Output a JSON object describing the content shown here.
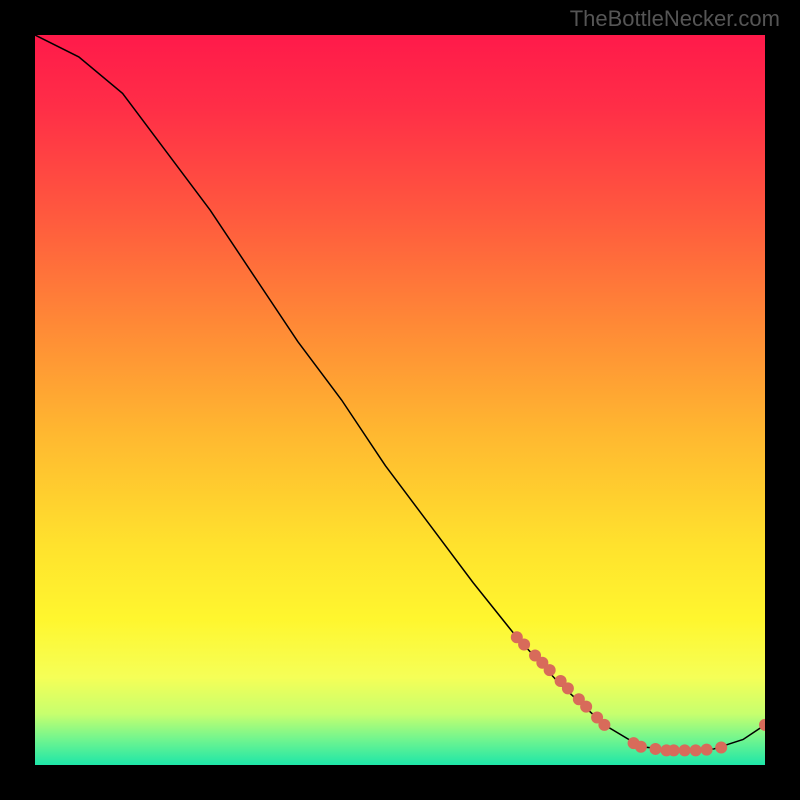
{
  "watermark": "TheBottleNecker.com",
  "chart_data": {
    "type": "line",
    "title": "",
    "xlabel": "",
    "ylabel": "",
    "xlim": [
      0,
      100
    ],
    "ylim": [
      0,
      100
    ],
    "curve": [
      {
        "x": 0,
        "y": 100
      },
      {
        "x": 6,
        "y": 97
      },
      {
        "x": 12,
        "y": 92
      },
      {
        "x": 18,
        "y": 84
      },
      {
        "x": 24,
        "y": 76
      },
      {
        "x": 30,
        "y": 67
      },
      {
        "x": 36,
        "y": 58
      },
      {
        "x": 42,
        "y": 50
      },
      {
        "x": 48,
        "y": 41
      },
      {
        "x": 54,
        "y": 33
      },
      {
        "x": 60,
        "y": 25
      },
      {
        "x": 66,
        "y": 17.5
      },
      {
        "x": 72,
        "y": 11
      },
      {
        "x": 78,
        "y": 5.5
      },
      {
        "x": 83,
        "y": 2.5
      },
      {
        "x": 88,
        "y": 2.0
      },
      {
        "x": 93,
        "y": 2.2
      },
      {
        "x": 97,
        "y": 3.5
      },
      {
        "x": 100,
        "y": 5.5
      }
    ],
    "markers": [
      {
        "x": 66,
        "y": 17.5
      },
      {
        "x": 67,
        "y": 16.5
      },
      {
        "x": 68.5,
        "y": 15
      },
      {
        "x": 69.5,
        "y": 14
      },
      {
        "x": 70.5,
        "y": 13
      },
      {
        "x": 72,
        "y": 11.5
      },
      {
        "x": 73,
        "y": 10.5
      },
      {
        "x": 74.5,
        "y": 9
      },
      {
        "x": 75.5,
        "y": 8
      },
      {
        "x": 77,
        "y": 6.5
      },
      {
        "x": 78,
        "y": 5.5
      },
      {
        "x": 82,
        "y": 3
      },
      {
        "x": 83,
        "y": 2.5
      },
      {
        "x": 85,
        "y": 2.2
      },
      {
        "x": 86.5,
        "y": 2.0
      },
      {
        "x": 87.5,
        "y": 2.0
      },
      {
        "x": 89,
        "y": 2.0
      },
      {
        "x": 90.5,
        "y": 2.0
      },
      {
        "x": 92,
        "y": 2.1
      },
      {
        "x": 94,
        "y": 2.4
      },
      {
        "x": 100,
        "y": 5.5
      }
    ],
    "gradient_stops": [
      {
        "offset": 0.0,
        "color": "#ff1a4a"
      },
      {
        "offset": 0.1,
        "color": "#ff2e47"
      },
      {
        "offset": 0.25,
        "color": "#ff5a3e"
      },
      {
        "offset": 0.4,
        "color": "#ff8a36"
      },
      {
        "offset": 0.55,
        "color": "#ffb930"
      },
      {
        "offset": 0.7,
        "color": "#ffe22d"
      },
      {
        "offset": 0.8,
        "color": "#fff62e"
      },
      {
        "offset": 0.88,
        "color": "#f5ff57"
      },
      {
        "offset": 0.93,
        "color": "#c7ff6e"
      },
      {
        "offset": 0.965,
        "color": "#70f58f"
      },
      {
        "offset": 1.0,
        "color": "#1ee6a8"
      }
    ],
    "marker_color": "#d86b5a",
    "curve_color": "#000000"
  }
}
